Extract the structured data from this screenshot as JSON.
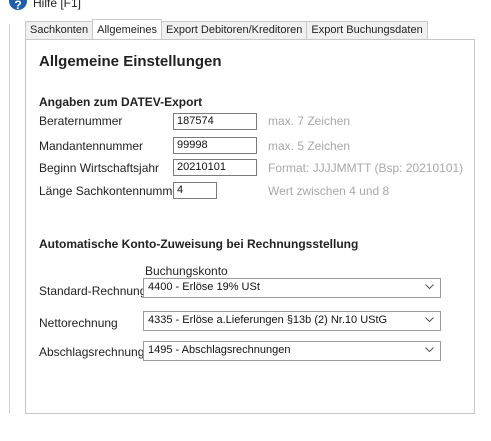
{
  "help": {
    "label": "Hilfe  [F1]",
    "icon": "help-icon"
  },
  "tabs": [
    {
      "label": "Sachkonten",
      "active": false
    },
    {
      "label": "Allgemeines",
      "active": true
    },
    {
      "label": "Export Debitoren/Kreditoren",
      "active": false
    },
    {
      "label": "Export Buchungsdaten",
      "active": false
    }
  ],
  "page": {
    "title": "Allgemeine Einstellungen"
  },
  "datev": {
    "section_title": "Angaben zum DATEV-Export",
    "berater": {
      "label": "Beraternummer",
      "value": "187574",
      "hint": "max. 7 Zeichen"
    },
    "mandant": {
      "label": "Mandantennummer",
      "value": "99998",
      "hint": "max. 5 Zeichen"
    },
    "beginn": {
      "label": "Beginn Wirtschaftsjahr",
      "value": "20210101",
      "hint": "Format: JJJJMMTT (Bsp: 20210101)"
    },
    "laenge": {
      "label": "Länge Sachkontennummer",
      "value": "4",
      "hint": "Wert zwischen 4 und 8"
    }
  },
  "konto": {
    "section_title": "Automatische Konto-Zuweisung bei Rechnungsstellung",
    "column_label": "Buchungskonto",
    "standard": {
      "label": "Standard-Rechnung",
      "value": "4400 - Erlöse 19% USt"
    },
    "netto": {
      "label": "Nettorechnung",
      "value": "4335 - Erlöse a.Lieferungen §13b (2) Nr.10 UStG"
    },
    "abschlag": {
      "label": "Abschlagsrechnung",
      "value": "1495 - Abschlagsrechnungen"
    }
  }
}
